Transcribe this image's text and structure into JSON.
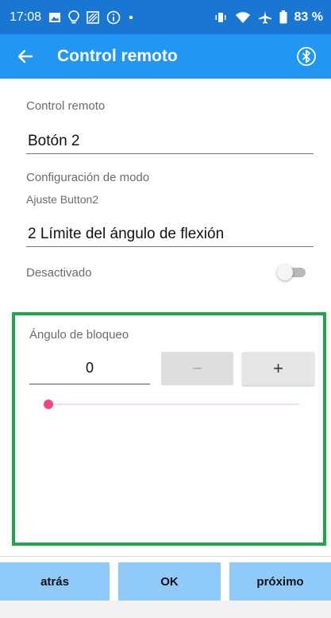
{
  "status_bar": {
    "time": "17:08",
    "battery": "83 %",
    "icons_left": [
      "image-icon",
      "bulb-icon",
      "gallery-icon",
      "info-icon",
      "dot-icon"
    ],
    "icons_right": [
      "vibrate-icon",
      "wifi-icon",
      "airplane-icon",
      "battery-icon"
    ]
  },
  "app_bar": {
    "title": "Control remoto",
    "back_icon": "arrow-left-icon",
    "action_icon": "bluetooth-icon",
    "background": "#2196f3"
  },
  "form": {
    "remote_label": "Control remoto",
    "remote_value": "Botón 2",
    "mode_label": "Configuración de modo",
    "mode_sublabel": "Ajuste Button2",
    "mode_value": "2 Límite del ángulo de flexión",
    "switch_label": "Desactivado",
    "switch_on": false
  },
  "lock_angle": {
    "label": "Ángulo de bloqueo",
    "value": "0",
    "minus_label": "−",
    "plus_label": "+",
    "slider_fraction": 0,
    "accent": "#f0457d",
    "border_color": "#1fa64a"
  },
  "bottom_nav": {
    "back_label": "atrás",
    "ok_label": "OK",
    "next_label": "próximo",
    "button_color": "#90caf9"
  }
}
